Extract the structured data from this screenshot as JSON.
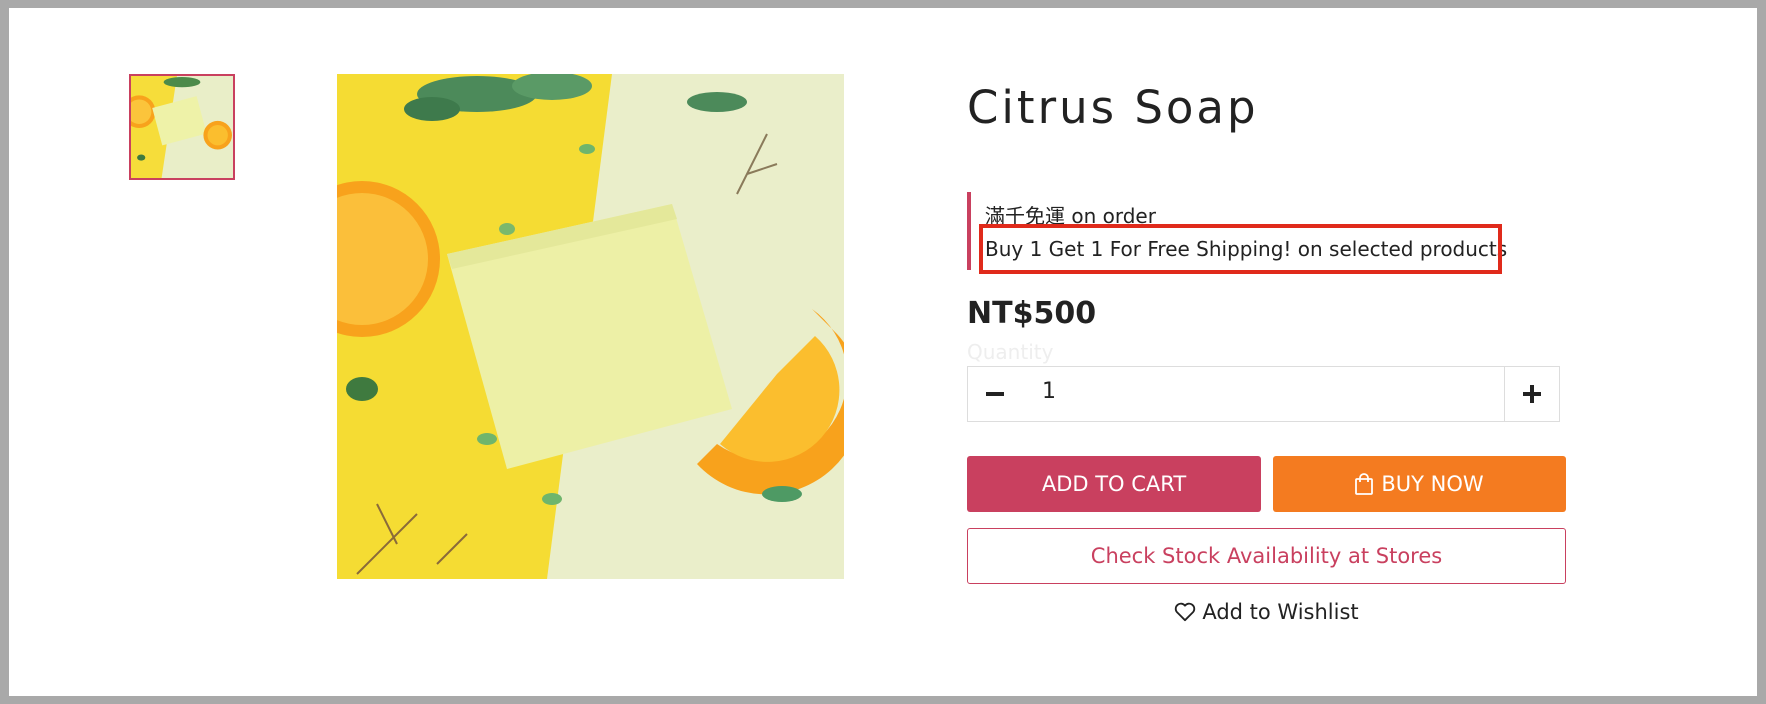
{
  "product": {
    "title": "Citrus Soap",
    "price": "NT$500"
  },
  "promotions": [
    "滿千免運 on order",
    "Buy 1 Get 1 For Free Shipping! on selected products"
  ],
  "quantity": {
    "label": "Quantity",
    "value": "1",
    "minus_icon": "minus-icon",
    "plus_icon": "plus-icon"
  },
  "buttons": {
    "add_to_cart": "ADD TO CART",
    "buy_now": "BUY NOW",
    "check_stock": "Check Stock Availability at Stores",
    "wishlist": "Add to Wishlist"
  },
  "icons": {
    "buy_now": "shopping-bag-icon",
    "wishlist": "heart-icon"
  },
  "colors": {
    "brand": "#c9405f",
    "buy_now": "#f47b20",
    "highlight": "#e02a1b"
  }
}
